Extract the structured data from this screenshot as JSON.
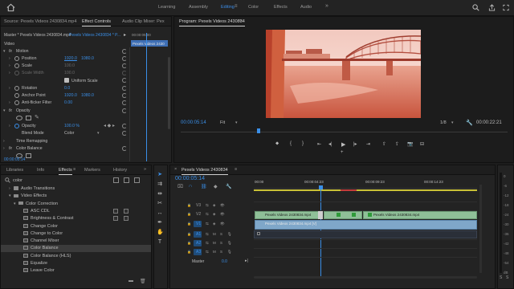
{
  "workspaces": [
    {
      "label": "Learning",
      "active": false
    },
    {
      "label": "Assembly",
      "active": false
    },
    {
      "label": "Editing",
      "active": true
    },
    {
      "label": "Color",
      "active": false
    },
    {
      "label": "Effects",
      "active": false
    },
    {
      "label": "Audio",
      "active": false
    }
  ],
  "source_panel": {
    "tabs": [
      {
        "label": "Source: Pexels Videos 2430834.mp4",
        "active": false
      },
      {
        "label": "Effect Controls",
        "active": true
      },
      {
        "label": "Audio Clip Mixer: Pex",
        "active": false
      }
    ],
    "master_label": "Master * Pexels Videos 2430834.mp4",
    "sequence_label": "Pexels Videos 2430834 * P...",
    "clip_timecode": "00:00:05:00",
    "clip_bar_label": "Pexels Videos 2430",
    "section_video": "Video",
    "motion": "Motion",
    "position_label": "Position",
    "position_x": "1920.0",
    "position_y": "1080.0",
    "scale_label": "Scale",
    "scale_value": "100.0",
    "scale_width_label": "Scale Width",
    "scale_width_value": "100.0",
    "uniform_scale": "Uniform Scale",
    "rotation_label": "Rotation",
    "rotation_value": "0.0",
    "anchor_label": "Anchor Point",
    "anchor_x": "1920.0",
    "anchor_y": "1080.0",
    "antiflicker_label": "Anti-flicker Filter",
    "antiflicker_value": "0.00",
    "opacity_section": "Opacity",
    "opacity_label": "Opacity",
    "opacity_value": "100.0 %",
    "blend_label": "Blend Mode",
    "blend_value": "Color",
    "time_remap": "Time Remapping",
    "color_balance": "Color Balance",
    "footer_timecode": "00:00:05:14"
  },
  "program": {
    "title": "Program: Pexels Videos 2430834",
    "timecode": "00:00:05:14",
    "fit": "Fit",
    "resolution": "1/8",
    "duration": "00:00:22:21"
  },
  "effects_panel": {
    "tabs": [
      {
        "label": "Libraries",
        "active": false
      },
      {
        "label": "Info",
        "active": false
      },
      {
        "label": "Effects",
        "active": true
      },
      {
        "label": "Markers",
        "active": false
      },
      {
        "label": "History",
        "active": false
      }
    ],
    "search_value": "color",
    "items": [
      {
        "label": "Audio Transitions",
        "indent": 1,
        "kind": "folder"
      },
      {
        "label": "Video Effects",
        "indent": 1,
        "kind": "folder"
      },
      {
        "label": "Color Correction",
        "indent": 2,
        "kind": "folder"
      },
      {
        "label": "ASC CDL",
        "indent": 3,
        "kind": "fx"
      },
      {
        "label": "Brightness & Contrast",
        "indent": 3,
        "kind": "fx"
      },
      {
        "label": "Change Color",
        "indent": 3,
        "kind": "fx"
      },
      {
        "label": "Change to Color",
        "indent": 3,
        "kind": "fx"
      },
      {
        "label": "Channel Mixer",
        "indent": 3,
        "kind": "fx"
      },
      {
        "label": "Color Balance",
        "indent": 3,
        "kind": "fx",
        "selected": true
      },
      {
        "label": "Color Balance (HLS)",
        "indent": 3,
        "kind": "fx"
      },
      {
        "label": "Equalize",
        "indent": 3,
        "kind": "fx"
      },
      {
        "label": "Leave Color",
        "indent": 3,
        "kind": "fx"
      }
    ]
  },
  "timeline": {
    "title": "Pexels Videos 2430834",
    "timecode": "00:00:05:14",
    "ruler": [
      "00:00",
      "00:00:04:23",
      "00:00:09:23",
      "00:00:14:23"
    ],
    "tracks_video": [
      "V3",
      "V2",
      "V1"
    ],
    "tracks_audio": [
      "A1",
      "A2",
      "A3"
    ],
    "master_label": "Master",
    "master_value": "0.0",
    "clip_v2_a": "Pexels Videos 2430834.mp4",
    "clip_v2_b": "Pexels Videos 2430834.mp4",
    "clip_v1": "Pexels Videos 2430834.mp4 [V]",
    "meter_labels": [
      "0",
      "-6",
      "-12",
      "-18",
      "-24",
      "-30",
      "-36",
      "-42",
      "-48",
      "-54",
      "dB"
    ]
  },
  "colors": {
    "accent": "#3a8fe8",
    "clip_video": "#8fbf98",
    "clip_audio": "#5d8fd6"
  }
}
